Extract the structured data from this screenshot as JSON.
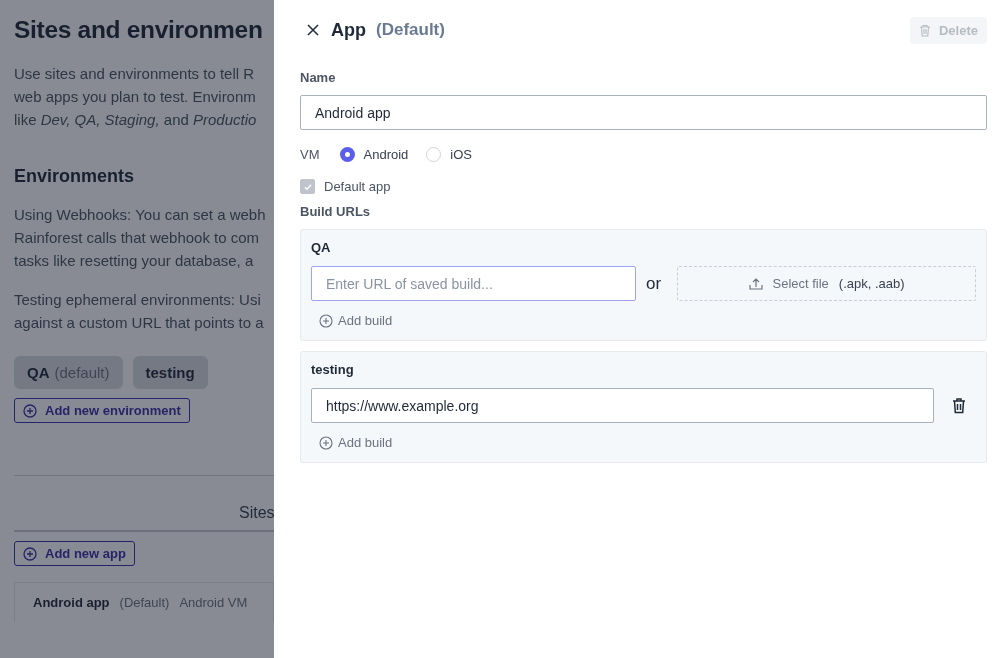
{
  "page": {
    "title": "Sites and environmen",
    "intro": [
      "Use sites and environments to tell R",
      "web apps you plan to test. Environm",
      "like *Dev, QA, Staging,* and *Productio*"
    ],
    "environments_heading": "Environments",
    "webhooks_text": [
      "Using Webhooks: You can set a webh",
      "Rainforest calls that webhook to com",
      "tasks like resetting your database, a"
    ],
    "ephemeral_text": [
      "Testing ephemeral environments: Usi",
      "against a custom URL that points to a"
    ],
    "environment_chips": [
      {
        "name": "QA",
        "note": "(default)"
      },
      {
        "name": "testing"
      }
    ],
    "add_environment_button": "Add new environment",
    "sites_tab": "Sites",
    "add_app_button": "Add new app",
    "apps": [
      {
        "name": "Android app",
        "default": "(Default)",
        "vm": "Android VM"
      }
    ]
  },
  "panel": {
    "title": "App",
    "subtitle": "(Default)",
    "delete_button": {
      "label": "Delete",
      "disabled": true
    },
    "name_label": "Name",
    "name_value": "Android app",
    "vm_label": "VM",
    "vm_options": [
      {
        "label": "Android",
        "selected": true
      },
      {
        "label": "iOS",
        "selected": false
      }
    ],
    "default_app": {
      "label": "Default app",
      "checked": true,
      "disabled": true
    },
    "build_urls_label": "Build URLs",
    "environments": [
      {
        "name": "QA",
        "builds": [
          {
            "kind": "empty",
            "placeholder": "Enter URL of saved build...",
            "focused": true
          }
        ],
        "or_label": "or",
        "select_file": "Select file",
        "file_types": "(.apk, .aab)",
        "add_build": "Add build"
      },
      {
        "name": "testing",
        "builds": [
          {
            "kind": "filled",
            "value": "https://www.example.org",
            "focused": false
          }
        ],
        "add_build": "Add build"
      }
    ]
  }
}
